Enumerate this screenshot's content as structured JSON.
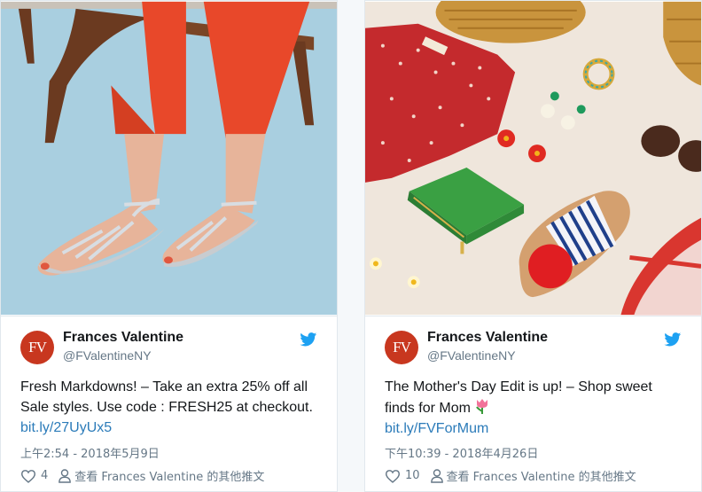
{
  "tweets": [
    {
      "avatar_text": "FV",
      "name": "Frances Valentine",
      "handle": "@FValentineNY",
      "text": "Fresh Markdowns! – Take an extra 25% off all Sale styles. Use code : FRESH25 at checkout.",
      "link": "bit.ly/27UyUx5",
      "time": "上午2:54 - 2018年5月9日",
      "likes": "4",
      "profile_link": "查看 Frances Valentine 的其他推文",
      "photo_desc": "Legs in orange pants wearing silver strappy sandals on a light blue floor, wooden chair"
    },
    {
      "avatar_text": "FV",
      "name": "Frances Valentine",
      "handle": "@FValentineNY",
      "text": "The Mother's Day Edit is up! – Shop sweet finds for Mom",
      "emoji": "tulip-icon",
      "link": "bit.ly/FVForMum",
      "time": "下午10:39 - 2018年4月26日",
      "likes": "10",
      "profile_link": "查看 Frances Valentine 的其他推文",
      "photo_desc": "Flat lay: red floral dress, green wallet, striped slide with red pompom, red flats, earrings, sunglasses, wicker basket"
    }
  ],
  "colors": {
    "brand": "#c8371f",
    "link": "#2b7bb9",
    "twitter": "#1da1f2"
  }
}
